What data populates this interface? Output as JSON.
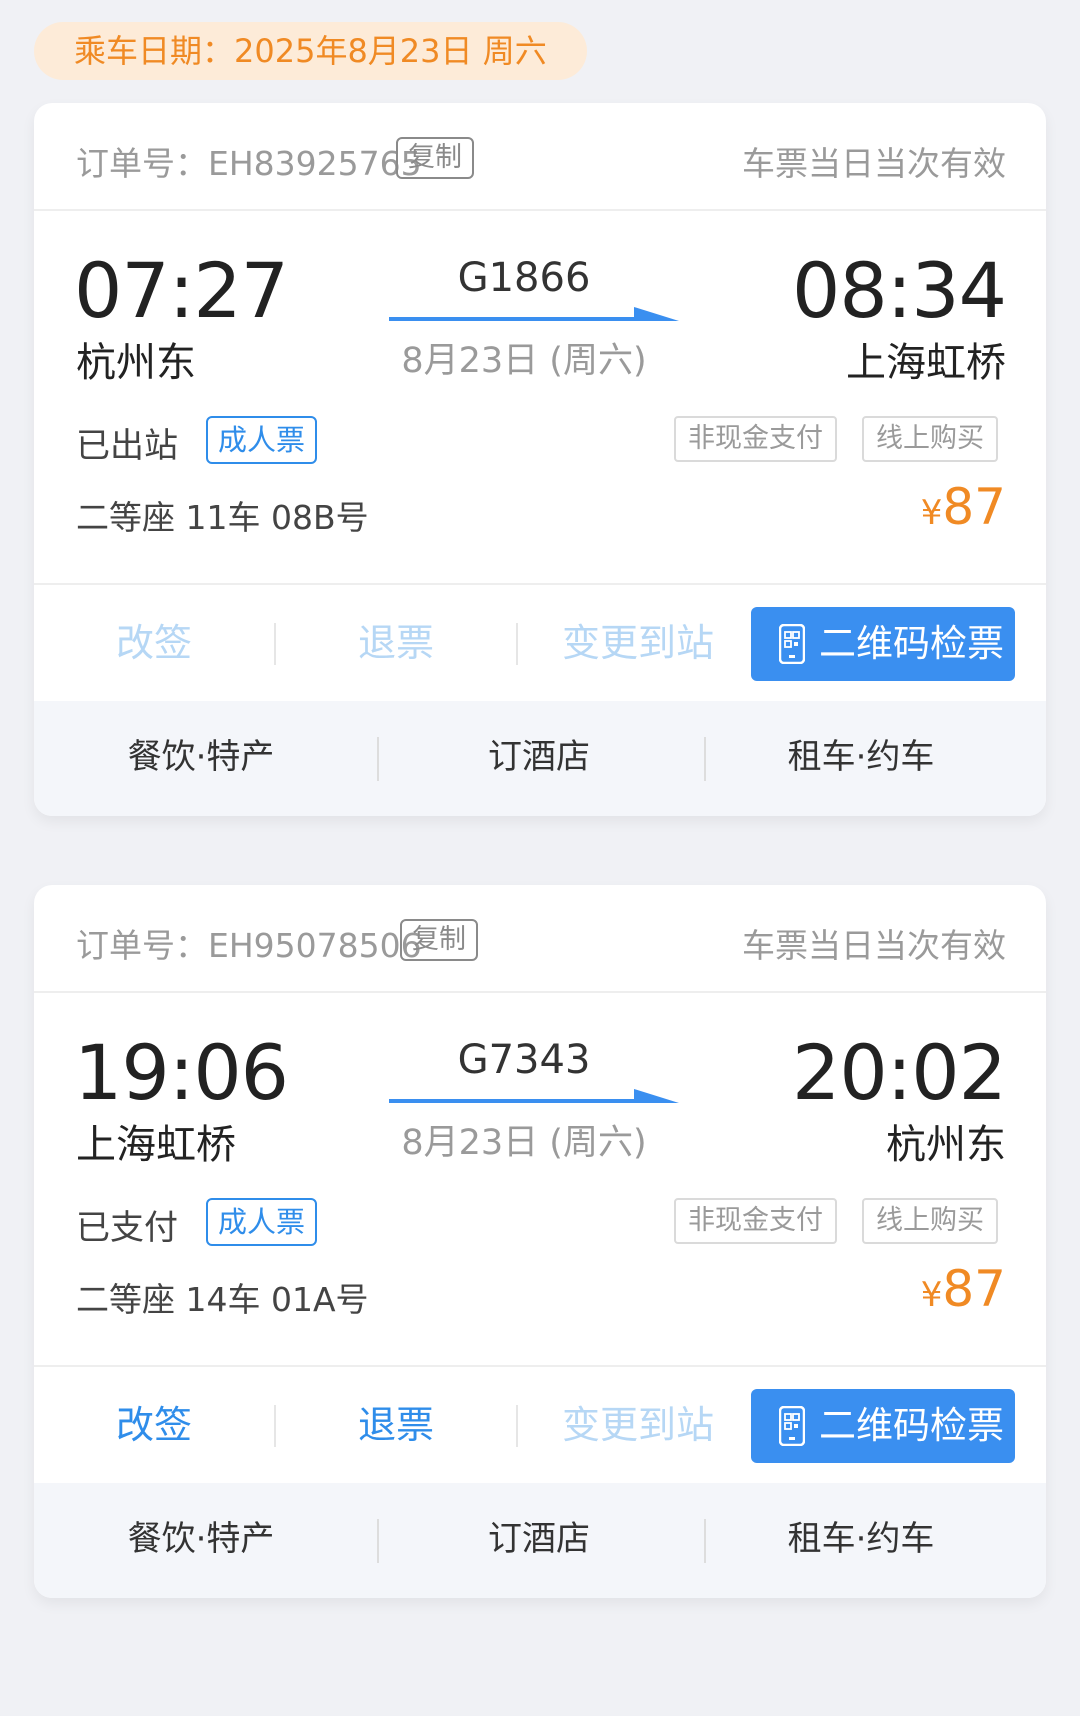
{
  "travel_date": "乘车日期：2025年8月23日 周六",
  "orders": [
    {
      "order_label": "订单号：EH83925765",
      "copy_label": "复制",
      "validity": "车票当日当次有效",
      "departure_time": "07:27",
      "departure_station": "杭州东",
      "train_number": "G1866",
      "train_date": "8月23日 (周六)",
      "arrival_time": "08:34",
      "arrival_station": "上海虹桥",
      "status": "已出站",
      "ticket_type": "成人票",
      "tags": [
        "非现金支付",
        "线上购买"
      ],
      "seat": "二等座 11车 08B号",
      "currency": "¥",
      "price": "87",
      "actions": [
        {
          "label": "改签",
          "enabled": false
        },
        {
          "label": "退票",
          "enabled": false
        },
        {
          "label": "变更到站",
          "enabled": false
        }
      ],
      "qr_label": "二维码检票",
      "services": [
        "餐饮·特产",
        "订酒店",
        "租车·约车"
      ]
    },
    {
      "order_label": "订单号：EH95078506",
      "copy_label": "复制",
      "validity": "车票当日当次有效",
      "departure_time": "19:06",
      "departure_station": "上海虹桥",
      "train_number": "G7343",
      "train_date": "8月23日 (周六)",
      "arrival_time": "20:02",
      "arrival_station": "杭州东",
      "status": "已支付",
      "ticket_type": "成人票",
      "tags": [
        "非现金支付",
        "线上购买"
      ],
      "seat": "二等座 14车 01A号",
      "currency": "¥",
      "price": "87",
      "actions": [
        {
          "label": "改签",
          "enabled": true
        },
        {
          "label": "退票",
          "enabled": true
        },
        {
          "label": "变更到站",
          "enabled": false
        }
      ],
      "qr_label": "二维码检票",
      "services": [
        "餐饮·特产",
        "订酒店",
        "租车·约车"
      ]
    }
  ],
  "colors": {
    "accent_blue": "#3a8ff0",
    "price_orange": "#f08a24",
    "disabled_blue": "#b6d7f5"
  },
  "icons": {
    "qr": "phone-qr-icon",
    "direction": "direction-arrow-icon"
  }
}
